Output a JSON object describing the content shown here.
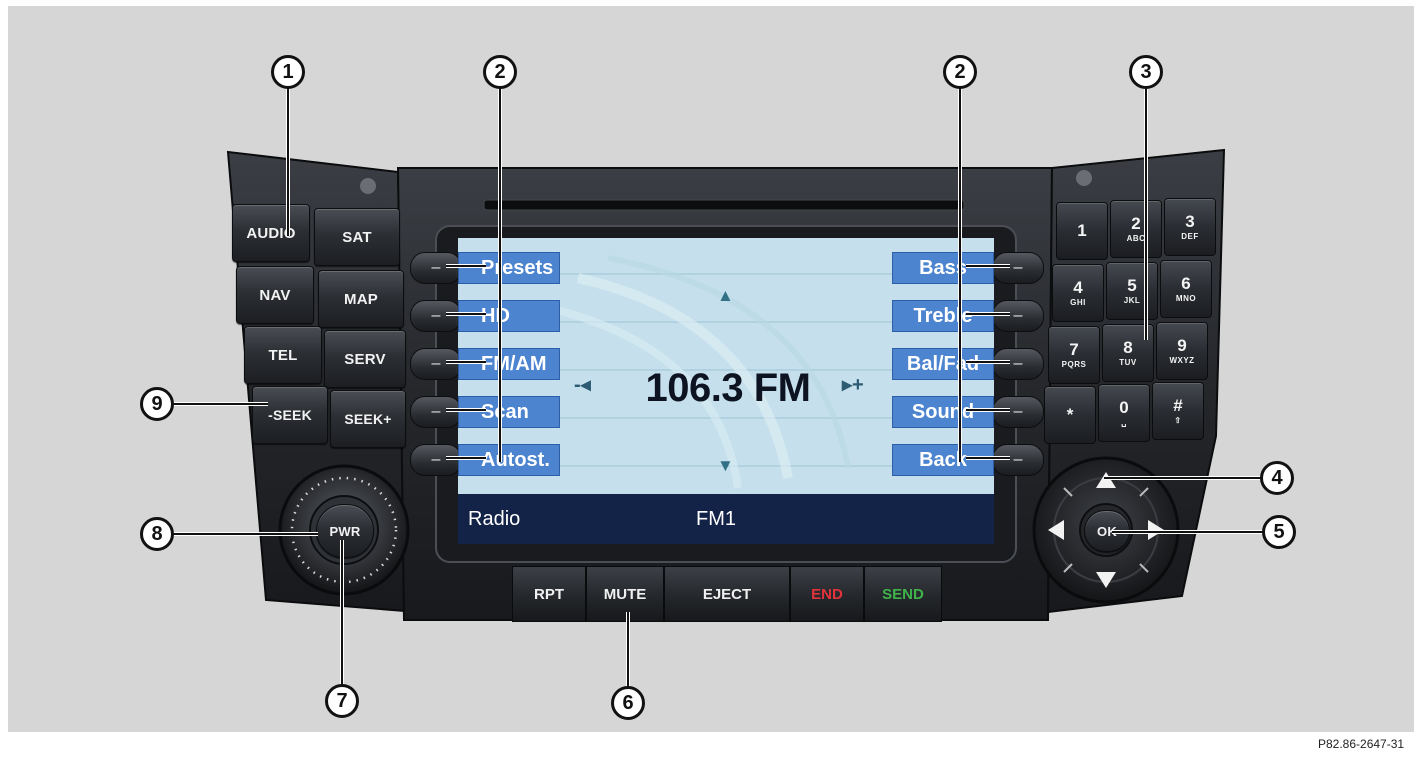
{
  "left_buttons": [
    {
      "label": "AUDIO"
    },
    {
      "label": "SAT"
    },
    {
      "label": "NAV"
    },
    {
      "label": "MAP"
    },
    {
      "label": "TEL"
    },
    {
      "label": "SERV"
    },
    {
      "label": "-SEEK"
    },
    {
      "label": "SEEK+"
    }
  ],
  "power_label": "PWR",
  "screen": {
    "left_softkeys": [
      "Presets",
      "HD",
      "FM/AM",
      "Scan",
      "Autost."
    ],
    "right_softkeys": [
      "Bass",
      "Treble",
      "Bal/Fad",
      "Sound",
      "Back"
    ],
    "frequency": "106.3 FM",
    "seek_left": "-◂",
    "seek_right": "▸+",
    "status_left": "Radio",
    "status_center": "FM1"
  },
  "keypad": [
    {
      "digit": "1",
      "letters": ""
    },
    {
      "digit": "2",
      "letters": "ABC"
    },
    {
      "digit": "3",
      "letters": "DEF"
    },
    {
      "digit": "4",
      "letters": "GHI"
    },
    {
      "digit": "5",
      "letters": "JKL"
    },
    {
      "digit": "6",
      "letters": "MNO"
    },
    {
      "digit": "7",
      "letters": "PQRS"
    },
    {
      "digit": "8",
      "letters": "TUV"
    },
    {
      "digit": "9",
      "letters": "WXYZ"
    },
    {
      "digit": "*",
      "letters": ""
    },
    {
      "digit": "0",
      "letters": "␣"
    },
    {
      "digit": "#",
      "letters": "⇧"
    }
  ],
  "nav_center_label": "OK",
  "bottom_buttons": [
    {
      "label": "RPT",
      "color": "#f0f0f0"
    },
    {
      "label": "MUTE",
      "color": "#f0f0f0"
    },
    {
      "label": "EJECT",
      "color": "#f0f0f0"
    },
    {
      "label": "END",
      "color": "#e2323a"
    },
    {
      "label": "SEND",
      "color": "#3fb44a"
    }
  ],
  "callouts": [
    "1",
    "2",
    "2",
    "3",
    "4",
    "5",
    "6",
    "7",
    "8",
    "9"
  ],
  "figure_code": "P82.86-2647-31"
}
